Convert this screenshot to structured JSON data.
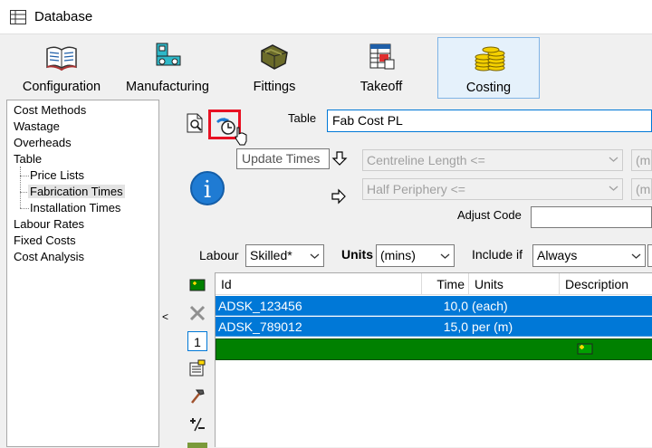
{
  "window": {
    "title": "Database"
  },
  "ribbon": {
    "tabs": [
      {
        "label": "Configuration",
        "icon": "book-icon"
      },
      {
        "label": "Manufacturing",
        "icon": "manufacturing-icon"
      },
      {
        "label": "Fittings",
        "icon": "fittings-icon"
      },
      {
        "label": "Takeoff",
        "icon": "takeoff-icon"
      },
      {
        "label": "Costing",
        "icon": "coins-icon",
        "active": true
      }
    ]
  },
  "nav": {
    "items": [
      {
        "label": "Cost Methods"
      },
      {
        "label": "Wastage"
      },
      {
        "label": "Overheads"
      },
      {
        "label": "Table"
      },
      {
        "label": "Price Lists"
      },
      {
        "label": "Fabrication Times",
        "selected": true
      },
      {
        "label": "Installation Times"
      },
      {
        "label": "Labour Rates"
      },
      {
        "label": "Fixed Costs"
      },
      {
        "label": "Cost Analysis"
      }
    ]
  },
  "collapse_glyph": "<",
  "tooltip": {
    "text": "Update Times"
  },
  "form": {
    "table_label": "Table",
    "table_value": "Fab Cost PL",
    "condition1_value": "Centreline Length <=",
    "condition1_unit": "(mm",
    "condition2_value": "Half Periphery <=",
    "condition2_unit": "(mm",
    "adjust_code_label": "Adjust Code",
    "adjust_code_value": ""
  },
  "filter": {
    "labour_label": "Labour",
    "labour_value": "Skilled*",
    "units_label": "Units",
    "units_value": "(mins)",
    "include_label": "Include if",
    "include_value": "Always"
  },
  "side_toolbar": {
    "counter": "1"
  },
  "grid": {
    "columns": [
      "Id",
      "Time",
      "Units",
      "Description"
    ],
    "rows": [
      {
        "id": "ADSK_123456",
        "time": "10,0",
        "units": "(each)",
        "description": ""
      },
      {
        "id": "ADSK_789012",
        "time": "15,0",
        "units": "per (m)",
        "description": ""
      }
    ]
  },
  "colors": {
    "selection": "#0078d7",
    "new_row": "#008000",
    "highlight_border": "#e81123",
    "info": "#1f7bd3"
  }
}
